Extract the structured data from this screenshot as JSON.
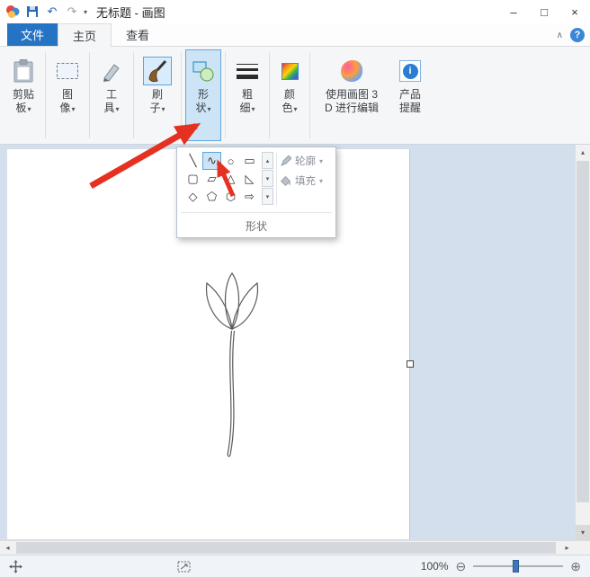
{
  "titlebar": {
    "title": "无标题 - 画图",
    "minimize": "–",
    "maximize": "□",
    "close": "×",
    "qat_dropdown": "▾"
  },
  "tabs": {
    "file": "文件",
    "home": "主页",
    "view": "查看",
    "collapse_icon": "∧",
    "help": "?"
  },
  "ribbon": {
    "clipboard": {
      "line1": "剪贴",
      "line2": "板",
      "caret": "▾"
    },
    "image": {
      "line1": "图",
      "line2": "像",
      "caret": "▾"
    },
    "tools": {
      "line1": "工",
      "line2": "具",
      "caret": "▾"
    },
    "brushes": {
      "line1": "刷",
      "line2": "子",
      "caret": "▾"
    },
    "shapes": {
      "line1": "形",
      "line2": "状",
      "caret": "▾"
    },
    "size": {
      "line1": "粗",
      "line2": "细",
      "caret": "▾"
    },
    "colors": {
      "line1": "颜",
      "line2": "色",
      "caret": "▾"
    },
    "paint3d": {
      "line1": "使用画图 3",
      "line2": "D 进行编辑"
    },
    "alerts": {
      "line1": "产品",
      "line2": "提醒",
      "info_glyph": "i"
    }
  },
  "shapes_panel": {
    "grid": [
      [
        "╲",
        "∿",
        "○",
        "▭"
      ],
      [
        "▢",
        "▱",
        "△",
        "◺"
      ],
      [
        "◇",
        "⬠",
        "⬡",
        "⇨"
      ]
    ],
    "scroll_up": "▴",
    "scroll_mid": "▾",
    "scroll_down": "▾",
    "outline_label": "轮廓",
    "outline_caret": "▾",
    "fill_label": "填充",
    "fill_caret": "▾",
    "footer_label": "形状"
  },
  "statusbar": {
    "zoom_label": "100%",
    "zoom_out_icon": "⊖",
    "zoom_in_icon": "⊕"
  },
  "scrollbars": {
    "up": "▴",
    "down": "▾",
    "left": "◂",
    "right": "▸"
  },
  "colors": {
    "annotation_red": "#e53122",
    "accent_blue": "#2b7cd3"
  }
}
